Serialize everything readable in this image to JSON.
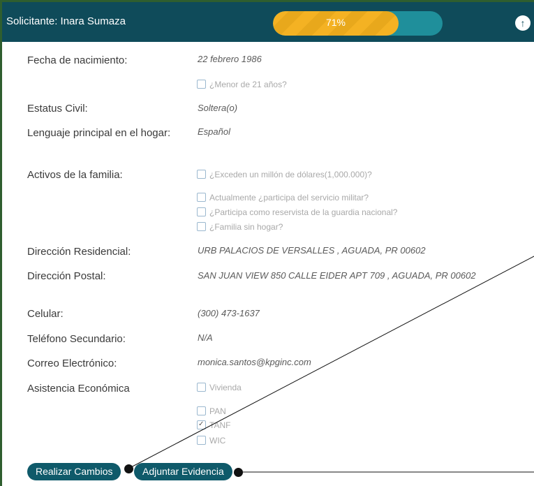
{
  "header": {
    "title": "Solicitante: Inara Sumaza",
    "progress_text": "71%",
    "progress_value": 0.71,
    "up_icon": "arrow-up-icon",
    "colors": {
      "header_bg": "#0f4b5a",
      "progress_fill": "#f4b223",
      "progress_track": "#1f8f9b"
    }
  },
  "fields": {
    "birth": {
      "label": "Fecha de nacimiento:",
      "value": "22 febrero 1986"
    },
    "under21": "¿Menor de 21 años?",
    "civil": {
      "label": "Estatus Civil:",
      "value": "Soltera(o)"
    },
    "language": {
      "label": "Lenguaje principal en el hogar:",
      "value": "Español"
    },
    "assets": {
      "label": "Activos de la familia:"
    },
    "assets_checks": [
      "¿Exceden un millón de dólares(1,000.000)?",
      "Actualmente ¿participa del servicio militar?",
      "¿Participa como reservista de la guardia nacional?",
      "¿Familia sin hogar?"
    ],
    "residential": {
      "label": "Dirección Residencial:",
      "value": "URB PALACIOS DE VERSALLES , AGUADA, PR 00602"
    },
    "postal": {
      "label": "Dirección Postal:",
      "value": "SAN JUAN VIEW 850 CALLE EIDER APT 709 , AGUADA, PR 00602"
    },
    "cell": {
      "label": "Celular:",
      "value": "(300) 473-1637"
    },
    "secondary_phone": {
      "label": "Teléfono Secundario:",
      "value": "N/A"
    },
    "email": {
      "label": "Correo Electrónico:",
      "value": "monica.santos@kpginc.com"
    },
    "assistance": {
      "label": "Asistencia Económica"
    },
    "assistance_checks": [
      {
        "label": "Vivienda",
        "checked": false
      },
      {
        "label": "PAN",
        "checked": false
      },
      {
        "label": "TANF",
        "checked": true
      },
      {
        "label": "WIC",
        "checked": false
      }
    ]
  },
  "buttons": {
    "make_changes": "Realizar Cambios",
    "attach_evidence": "Adjuntar Evidencia"
  }
}
